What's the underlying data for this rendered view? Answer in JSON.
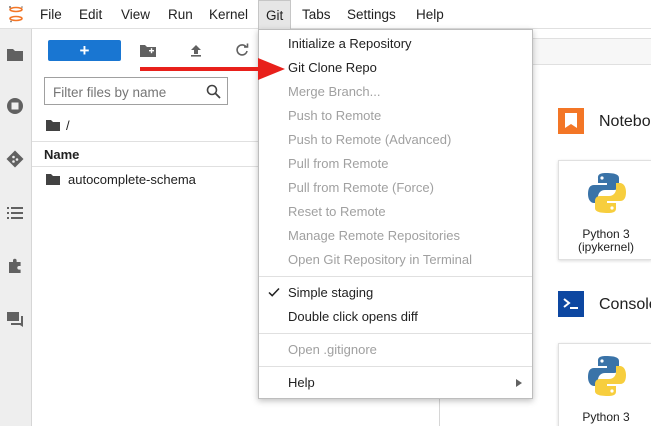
{
  "menubar": {
    "items": [
      "File",
      "Edit",
      "View",
      "Run",
      "Kernel",
      "Git",
      "Tabs",
      "Settings",
      "Help"
    ],
    "active": "Git"
  },
  "activitybar": {
    "icons": [
      "folder-icon",
      "running-icon",
      "git-icon",
      "toc-icon",
      "extension-icon",
      "chat-icon"
    ]
  },
  "filebrowser": {
    "new_label": "+",
    "filter_placeholder": "Filter files by name",
    "breadcrumb_root": "/",
    "column_name": "Name",
    "files": [
      {
        "name": "autocomplete-schema",
        "type": "folder"
      }
    ]
  },
  "git_menu": {
    "items": [
      {
        "label": "Initialize a Repository",
        "enabled": true
      },
      {
        "label": "Git Clone Repo",
        "enabled": true
      },
      {
        "label": "Merge Branch...",
        "enabled": false
      },
      {
        "label": "Push to Remote",
        "enabled": false
      },
      {
        "label": "Push to Remote (Advanced)",
        "enabled": false
      },
      {
        "label": "Pull from Remote",
        "enabled": false
      },
      {
        "label": "Pull from Remote (Force)",
        "enabled": false
      },
      {
        "label": "Reset to Remote",
        "enabled": false
      },
      {
        "label": "Manage Remote Repositories",
        "enabled": false
      },
      {
        "label": "Open Git Repository in Terminal",
        "enabled": false
      },
      {
        "label": "Simple staging",
        "enabled": true,
        "checked": true
      },
      {
        "label": "Double click opens diff",
        "enabled": true
      },
      {
        "label": "Open .gitignore",
        "enabled": false
      },
      {
        "label": "Help",
        "enabled": true,
        "submenu": true
      }
    ]
  },
  "launcher": {
    "notebook_section": "Notebook",
    "console_section": "Console",
    "kernel_name": "Python 3",
    "kernel_sub": "(ipykernel)"
  },
  "colors": {
    "accent": "#1976d2",
    "notebook_icon": "#f37626",
    "console_icon": "#0d47a1",
    "annotation_arrow": "#e8201b"
  }
}
